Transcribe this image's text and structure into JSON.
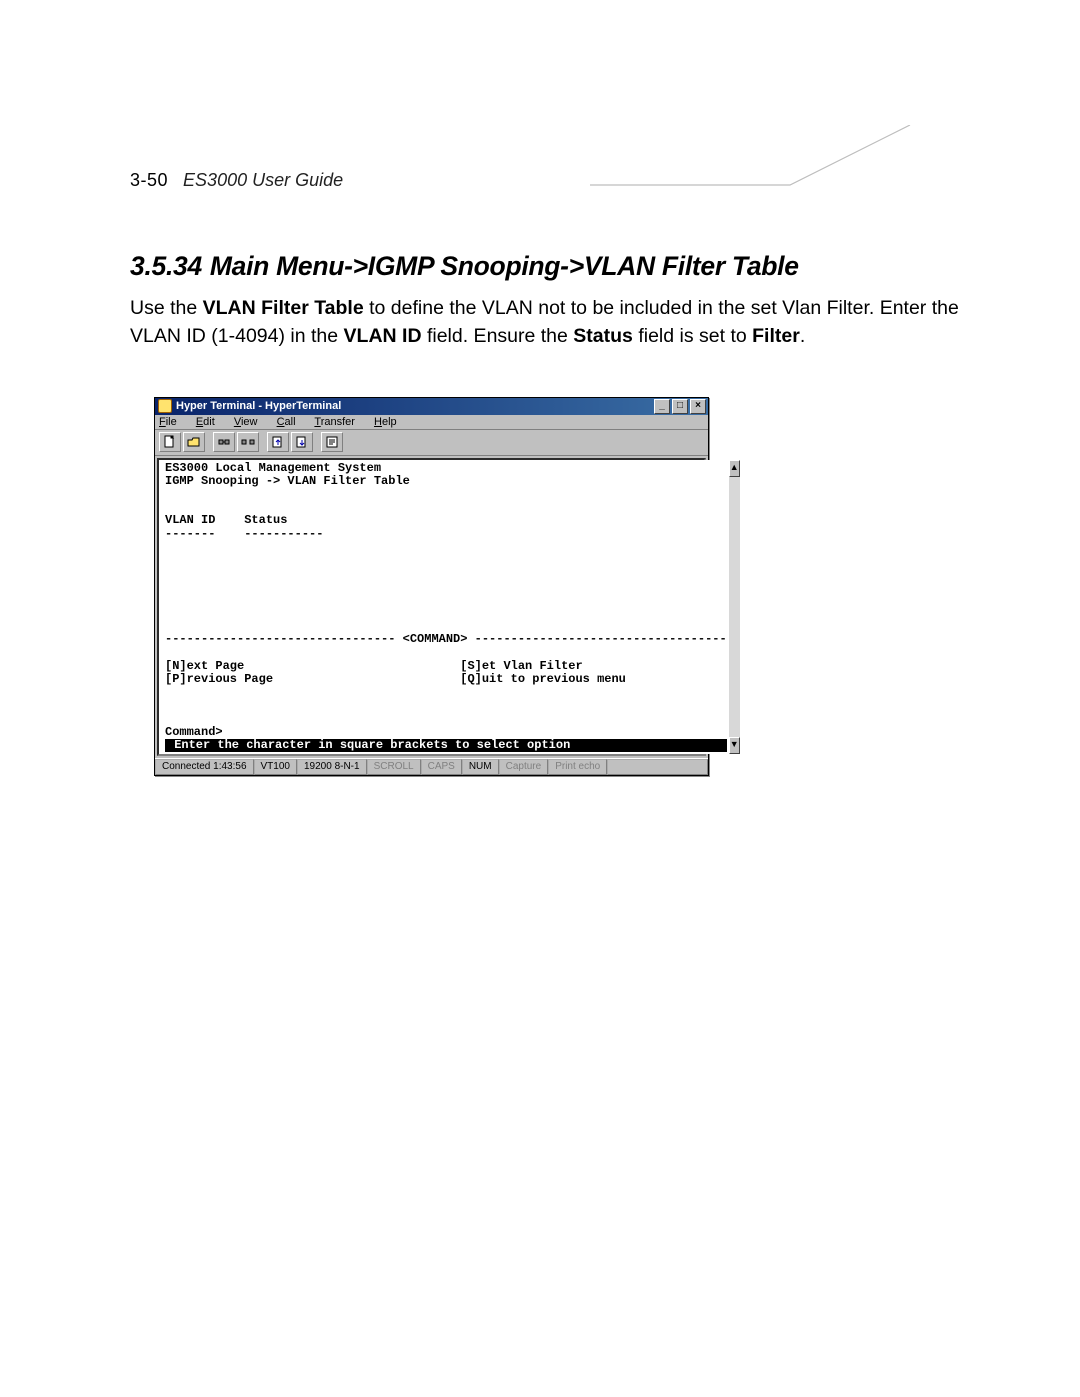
{
  "header": {
    "page_num": "3-50",
    "doc_title": "ES3000 User Guide"
  },
  "section": {
    "number": "3.5.34",
    "title": "Main Menu->IGMP Snooping->VLAN Filter Table"
  },
  "body": {
    "t0": "Use the ",
    "b0": "VLAN Filter Table",
    "t1": " to define the VLAN not to be included in the set Vlan Filter. Enter the VLAN ID (1-4094) in the ",
    "b1": "VLAN ID",
    "t2": " field. Ensure the ",
    "b2": "Status",
    "t3": " field is set to ",
    "b3": "Filter",
    "t4": "."
  },
  "ht": {
    "title": "Hyper Terminal - HyperTerminal",
    "menu": [
      {
        "u": "F",
        "r": "ile"
      },
      {
        "u": "E",
        "r": "dit"
      },
      {
        "u": "V",
        "r": "iew"
      },
      {
        "u": "C",
        "r": "all"
      },
      {
        "u": "T",
        "r": "ransfer"
      },
      {
        "u": "H",
        "r": "elp"
      }
    ],
    "term": {
      "line0": "ES3000 Local Management System",
      "line1": "IGMP Snooping -> VLAN Filter Table",
      "line2": "VLAN ID    Status",
      "line3": "-------    -----------",
      "line4": "-------------------------------- <COMMAND> -----------------------------------",
      "line5": "[N]ext Page                              [S]et Vlan Filter",
      "line6": "[P]revious Page                          [Q]uit to previous menu",
      "line7": "Command>",
      "line8": " Enter the character in square brackets to select option                     "
    },
    "status": [
      "Connected 1:43:56",
      "VT100",
      "19200 8-N-1",
      "SCROLL",
      "CAPS",
      "NUM",
      "Capture",
      "Print echo"
    ]
  }
}
